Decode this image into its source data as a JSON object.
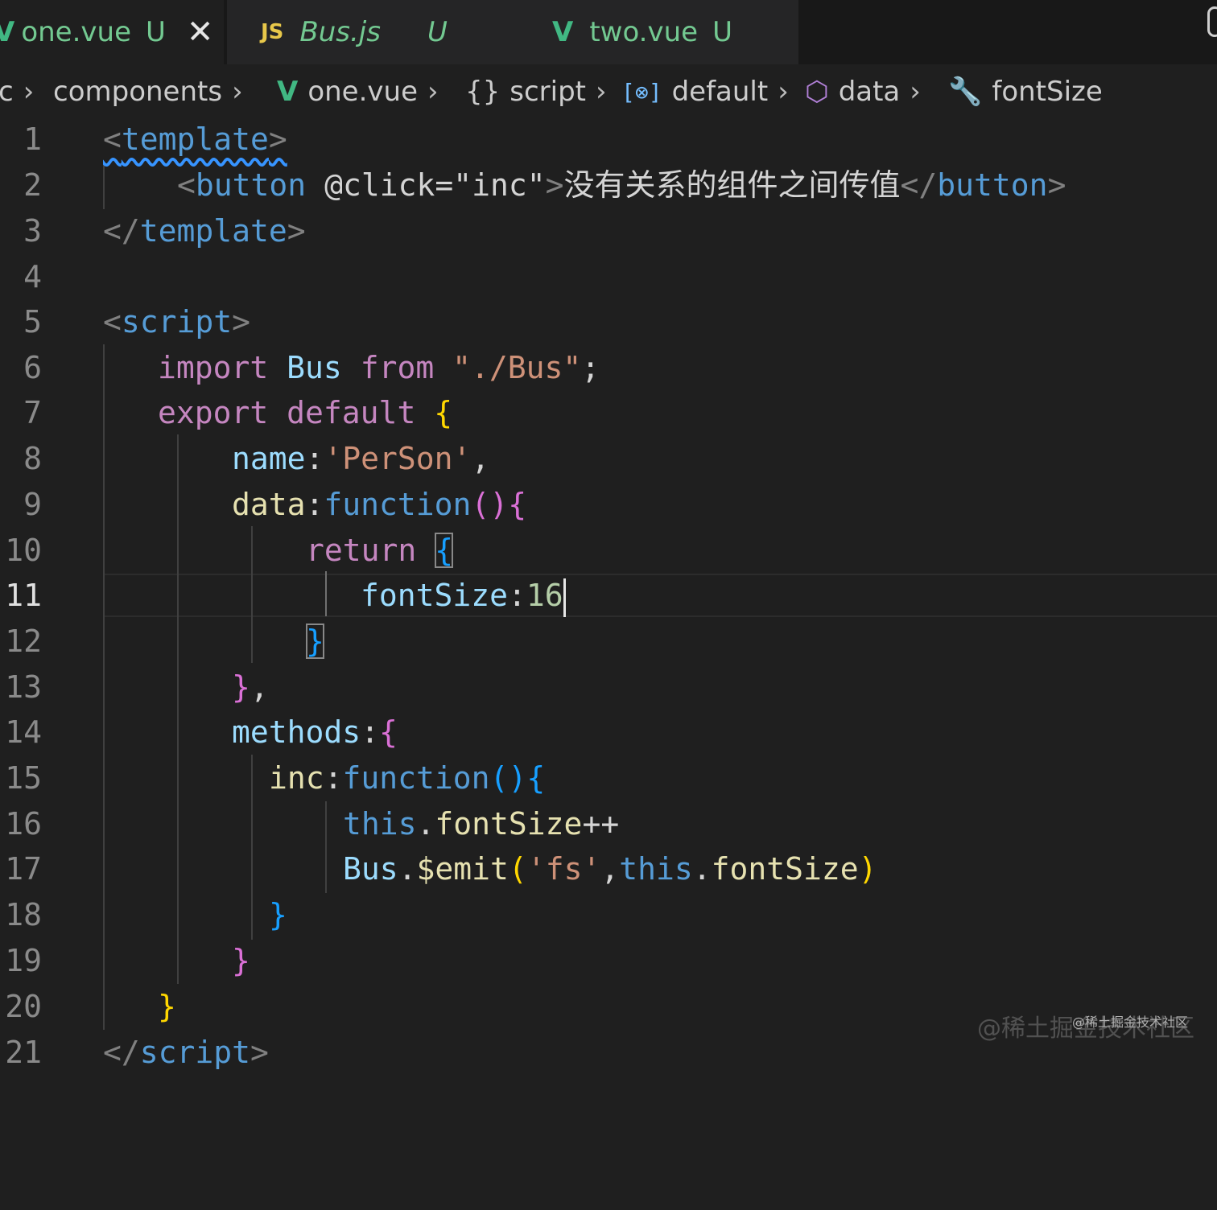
{
  "tabs": [
    {
      "icon": "vue-icon",
      "name": "one.vue",
      "badge": "U",
      "close": "✕",
      "active": true
    },
    {
      "icon": "js-icon",
      "icon_text": "JS",
      "name": "Bus.js",
      "badge": "U",
      "active": false
    },
    {
      "icon": "vue-icon",
      "name": "two.vue",
      "badge": "U",
      "active": false
    }
  ],
  "breadcrumb": {
    "items": [
      "c",
      "components",
      "one.vue",
      "script",
      "default",
      "data",
      "fontSize"
    ],
    "separator": "›",
    "icons": [
      "vue-icon",
      "braces-icon",
      "variable-icon",
      "cube-icon",
      "wrench-icon"
    ]
  },
  "editor": {
    "active_line": 11,
    "lines": [
      {
        "n": "1"
      },
      {
        "n": "2"
      },
      {
        "n": "3"
      },
      {
        "n": "4"
      },
      {
        "n": "5"
      },
      {
        "n": "6"
      },
      {
        "n": "7"
      },
      {
        "n": "8"
      },
      {
        "n": "9"
      },
      {
        "n": "10"
      },
      {
        "n": "11"
      },
      {
        "n": "12"
      },
      {
        "n": "13"
      },
      {
        "n": "14"
      },
      {
        "n": "15"
      },
      {
        "n": "16"
      },
      {
        "n": "17"
      },
      {
        "n": "18"
      },
      {
        "n": "19"
      },
      {
        "n": "20"
      },
      {
        "n": "21"
      }
    ],
    "tokens": {
      "lt": "<",
      "gt": ">",
      "lt_slash": "</",
      "template": "template",
      "button": "button",
      "at_click": "@click=",
      "inc_str": "\"inc\"",
      "button_text": "没有关系的组件之间传值",
      "script": "script",
      "import": "import",
      "bus": "Bus",
      "from": "from",
      "bus_path": "\"./Bus\"",
      "semi": ";",
      "export": "export",
      "default": "default",
      "lbrace": "{",
      "rbrace": "}",
      "rbrace_comma": "},",
      "name": "name",
      "colon": ":",
      "person_str": "'PerSon'",
      "comma": ",",
      "data": "data",
      "function": "function",
      "parens": "()",
      "lparen": "(",
      "rparen": ")",
      "return": "return",
      "fontsize": "fontSize",
      "sixteen": "16",
      "methods": "methods",
      "inc": "inc",
      "this": "this",
      "dot": ".",
      "plusplus": "++",
      "emit": "$emit",
      "fs_str": "'fs'"
    }
  },
  "colors": {
    "editor_bg": "#1f1f1f",
    "tab_inactive_bg": "#252526",
    "untracked_green": "#73c991",
    "vue_green": "#41b883",
    "js_yellow": "#e8c84a",
    "bracket_yellow": "#ffd700",
    "bracket_purple": "#da70d6",
    "bracket_blue": "#179fff"
  },
  "watermark": {
    "large": "@稀土掘金技术社区",
    "small": "@稀土掘金技术社区"
  }
}
